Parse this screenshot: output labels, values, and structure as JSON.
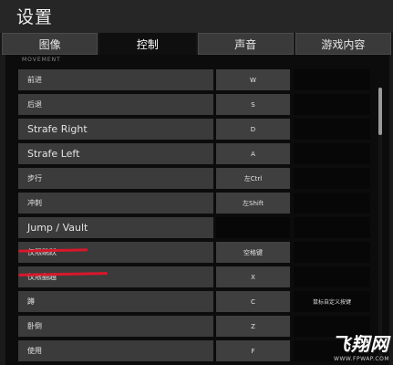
{
  "window": {
    "title": "设置"
  },
  "tabs": [
    {
      "label": "图像",
      "active": false
    },
    {
      "label": "控制",
      "active": true
    },
    {
      "label": "声音",
      "active": false
    },
    {
      "label": "游戏内容",
      "active": false
    }
  ],
  "section": {
    "header": "MOVEMENT"
  },
  "bindings": [
    {
      "action": "前进",
      "primary": "W",
      "secondary": ""
    },
    {
      "action": "后退",
      "primary": "S",
      "secondary": ""
    },
    {
      "action": "Strafe Right",
      "primary": "D",
      "secondary": ""
    },
    {
      "action": "Strafe Left",
      "primary": "A",
      "secondary": ""
    },
    {
      "action": "步行",
      "primary": "左Ctrl",
      "secondary": ""
    },
    {
      "action": "冲刺",
      "primary": "左Shift",
      "secondary": ""
    },
    {
      "action": "Jump / Vault",
      "primary": "",
      "secondary": ""
    },
    {
      "action": "仅限跳跃",
      "primary": "空格键",
      "secondary": ""
    },
    {
      "action": "仅限翻越",
      "primary": "X",
      "secondary": ""
    },
    {
      "action": "蹲",
      "primary": "C",
      "secondary": "鼠标自定义按键"
    },
    {
      "action": "卧倒",
      "primary": "Z",
      "secondary": ""
    },
    {
      "action": "使用",
      "primary": "F",
      "secondary": ""
    }
  ],
  "watermark": {
    "logo": "飞翔网",
    "url": "WWW.FPWAP.COM"
  },
  "colors": {
    "highlight_underline": "#d8172a",
    "active_tab": "#0f0f0f",
    "row_bg": "#3b3b3b"
  }
}
